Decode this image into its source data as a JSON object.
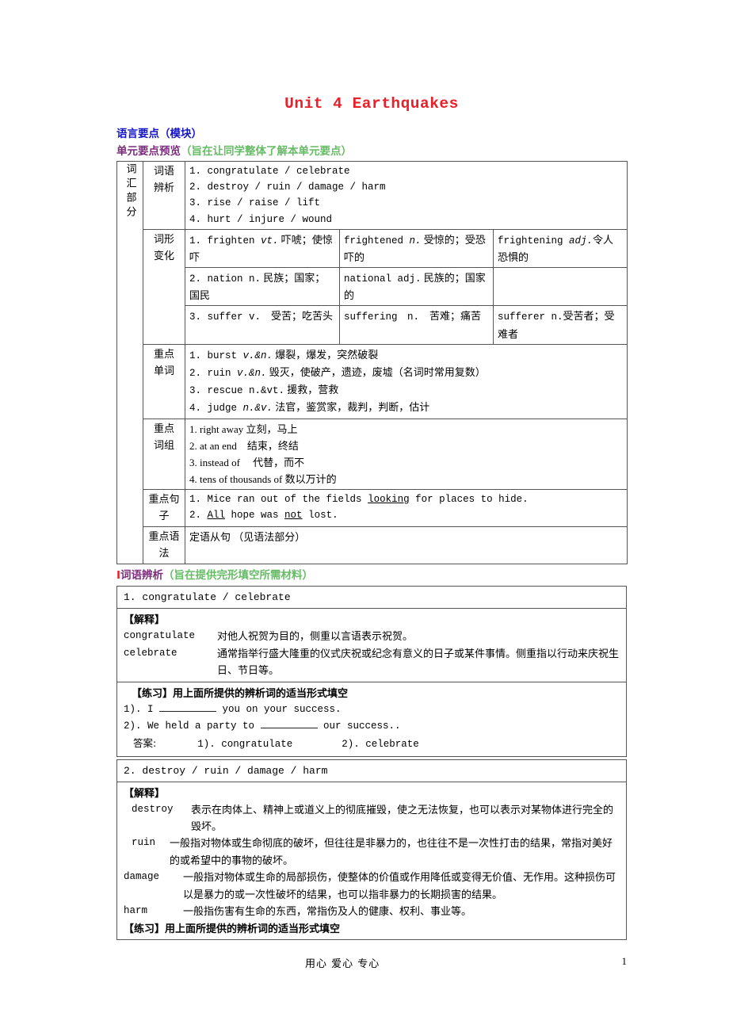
{
  "doc": {
    "title": "Unit 4  Earthquakes",
    "heading_language_points": "语言要点（模块）",
    "heading_unit_preview": "单元要点预览",
    "heading_unit_preview_note": "（旨在让同学整体了解本单元要点）",
    "section1_roman": "I",
    "section1_title": "词语辨析",
    "section1_note": "（旨在提供完形填空所需材料）"
  },
  "colors": {
    "title_red": "#e8202a",
    "heading_blue": "#1414c8",
    "heading_purple": "#7b2d7b",
    "heading_green": "#66bb66",
    "border": "#555555"
  },
  "outline_table": {
    "vertical_label": "词汇部分",
    "rows": {
      "word_discrimination": {
        "label": "词语\n辨析",
        "label_line1": "词语",
        "label_line2": "辨析",
        "items": [
          "1. congratulate / celebrate",
          "2. destroy / ruin / damage / harm",
          "3. rise / raise / lift",
          "4. hurt / injure / wound"
        ]
      },
      "word_forms": {
        "label_line1": "词形",
        "label_line2": "变化",
        "entries": [
          {
            "base": "1. frighten vt. 吓唬；使惊吓",
            "base_en": "1. frighten ",
            "base_pos": "vt.",
            "base_cn": " 吓唬；使惊吓",
            "form2_en": "frightened ",
            "form2_pos": "n.",
            "form2_cn": " 受惊的；受恐吓的",
            "form3_en": "frightening ",
            "form3_pos": "adj.",
            "form3_cn": "令人恐惧的"
          },
          {
            "base_en": "2. nation n.",
            "base_pos": "",
            "base_cn": " 民族；国家；国民",
            "form2_en": "national adj.",
            "form2_pos": "",
            "form2_cn": " 民族的；国家的",
            "form3_en": "",
            "form3_pos": "",
            "form3_cn": ""
          },
          {
            "base_en": "3. suffer v.",
            "base_pos": "",
            "base_cn": "　受苦；吃苦头",
            "form2_en": "suffering　n.",
            "form2_pos": "",
            "form2_cn": "　苦难；痛苦",
            "form3_en": "sufferer n.",
            "form3_pos": "",
            "form3_cn": "受苦者；受难者"
          }
        ]
      },
      "key_words": {
        "label_line1": "重点",
        "label_line2": "单词",
        "items": [
          "1. burst v.&n. 爆裂，爆发，突然破裂",
          "2. ruin v.&n. 毁灭，使破产，遗迹，废墟（名词时常用复数）",
          "3. rescue n.&vt. 援救，营救",
          "4. judge n.&v. 法官，鉴赏家，裁判，判断，估计"
        ],
        "items_parts": [
          {
            "num": "1. ",
            "en": "burst ",
            "pos": "v.&n.",
            "cn": " 爆裂，爆发，突然破裂"
          },
          {
            "num": "2. ",
            "en": "ruin ",
            "pos": "v.&n.",
            "cn": " 毁灭，使破产，遗迹，废墟（名词时常用复数）"
          },
          {
            "num": "3. ",
            "en": "rescue n.&vt.",
            "pos": "",
            "cn": " 援救，营救"
          },
          {
            "num": "4. ",
            "en": "judge ",
            "pos": "n.&v.",
            "cn": " 法官，鉴赏家，裁判，判断，估计"
          }
        ]
      },
      "key_phrases": {
        "label_line1": "重点",
        "label_line2": "词组",
        "items": [
          "1. right away 立刻，马上",
          "2. at an end　结束，终结",
          "3. instead of 　代替，而不",
          "4. tens of thousands of 数以万计的"
        ]
      },
      "key_sentences": {
        "label": "重点句子",
        "items": [
          {
            "num": "1. ",
            "pre": "Mice ran out of the fields ",
            "ul": "looking",
            "post": " for places to hide."
          },
          {
            "num": "2. ",
            "pre": "",
            "ul": "All",
            "mid": " hope was ",
            "ul2": "not",
            "post": " lost."
          }
        ]
      },
      "key_grammar": {
        "label": "重点语法",
        "value": "定语从句 （见语法部分）"
      }
    }
  },
  "word_block_1": {
    "header": "1. congratulate / celebrate",
    "explain_label": "【解释】",
    "defs": [
      {
        "term": "congratulate",
        "text": "对他人祝贺为目的，侧重以言语表示祝贺。"
      },
      {
        "term": "celebrate",
        "text": "通常指举行盛大隆重的仪式庆祝或纪念有意义的日子或某件事情。侧重指以行动来庆祝生日、节日等。"
      }
    ],
    "exercise_label": "【练习】用上面所提供的辨析词的适当形式填空",
    "questions": [
      {
        "pre": "1). I ",
        "post": " you on your success."
      },
      {
        "pre": "2). We held a party to ",
        "post": " our success.."
      }
    ],
    "answer_label": "答案:",
    "answers": [
      "1). congratulate",
      "2). celebrate"
    ]
  },
  "word_block_2": {
    "header": "2. destroy / ruin / damage / harm",
    "explain_label": "【解释】",
    "defs": [
      {
        "term": "destroy",
        "text": "表示在肉体上、精神上或道义上的彻底摧毁，使之无法恢复，也可以表示对某物体进行完全的毁坏。"
      },
      {
        "term": "ruin",
        "text": "一般指对物体或生命彻底的破坏，但往往是非暴力的，也往往不是一次性打击的结果，常指对美好的或希望中的事物的破坏。"
      },
      {
        "term": "damage",
        "text": "一般指对物体或生命的局部损伤，使整体的价值或作用降低或变得无价值、无作用。这种损伤可以是暴力的或一次性破坏的结果，也可以指非暴力的长期损害的结果。"
      },
      {
        "term": "harm",
        "text": "一般指伤害有生命的东西，常指伤及人的健康、权利、事业等。"
      }
    ],
    "exercise_label": "【练习】用上面所提供的辨析词的适当形式填空"
  },
  "footer": {
    "center_text": "用心 爱心 专心",
    "page_number": "1"
  }
}
